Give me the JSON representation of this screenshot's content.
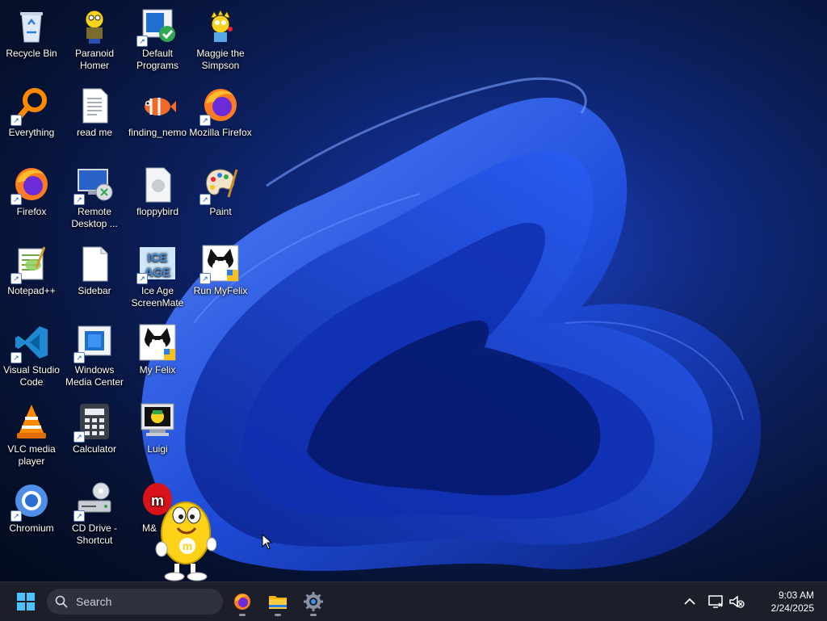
{
  "desktop": {
    "icons": [
      {
        "label": "Recycle Bin",
        "icon": "recycle-bin-icon",
        "shortcut": false
      },
      {
        "label": "Paranoid Homer",
        "icon": "homer-icon",
        "shortcut": false
      },
      {
        "label": "Default Programs",
        "icon": "default-programs-icon",
        "shortcut": true
      },
      {
        "label": "Maggie the Simpson",
        "icon": "maggie-icon",
        "shortcut": false
      },
      {
        "label": "Everything",
        "icon": "everything-search-icon",
        "shortcut": true
      },
      {
        "label": "read me",
        "icon": "text-file-icon",
        "shortcut": false
      },
      {
        "label": "finding_nemo",
        "icon": "nemo-fish-icon",
        "shortcut": false
      },
      {
        "label": "Mozilla Firefox",
        "icon": "firefox-icon",
        "shortcut": true
      },
      {
        "label": "Firefox",
        "icon": "firefox-icon",
        "shortcut": true
      },
      {
        "label": "Remote Desktop ...",
        "icon": "remote-desktop-icon",
        "shortcut": true
      },
      {
        "label": "floppybird",
        "icon": "generic-file-icon",
        "shortcut": false
      },
      {
        "label": "Paint",
        "icon": "paint-palette-icon",
        "shortcut": true
      },
      {
        "label": "Notepad++",
        "icon": "notepad-plus-plus-icon",
        "shortcut": true
      },
      {
        "label": "Sidebar",
        "icon": "blank-file-icon",
        "shortcut": false
      },
      {
        "label": "Ice Age ScreenMate",
        "icon": "ice-age-icon",
        "shortcut": true
      },
      {
        "label": "Run MyFelix",
        "icon": "felix-cat-icon",
        "shortcut": true
      },
      {
        "label": "Visual Studio Code",
        "icon": "vscode-icon",
        "shortcut": true
      },
      {
        "label": "Windows Media Center",
        "icon": "media-center-icon",
        "shortcut": true
      },
      {
        "label": "My Felix",
        "icon": "felix-cat-icon",
        "shortcut": false
      },
      {
        "label": "VLC media player",
        "icon": "vlc-cone-icon",
        "shortcut": false
      },
      {
        "label": "Calculator",
        "icon": "calculator-icon",
        "shortcut": true
      },
      {
        "label": "Luigi",
        "icon": "luigi-monitor-icon",
        "shortcut": false
      },
      {
        "label": "Chromium",
        "icon": "chromium-icon",
        "shortcut": true
      },
      {
        "label": "CD Drive - Shortcut",
        "icon": "cd-drive-icon",
        "shortcut": true
      },
      {
        "label": "M&",
        "icon": "m-and-m-icon",
        "shortcut": false
      }
    ]
  },
  "taskbar": {
    "start_icon": "windows-start-icon",
    "search_placeholder": "Search",
    "pinned": [
      {
        "name": "firefox",
        "icon": "firefox-icon",
        "running": true
      },
      {
        "name": "file-explorer",
        "icon": "folder-icon",
        "running": true
      },
      {
        "name": "settings",
        "icon": "gear-icon",
        "running": true
      }
    ],
    "tray": {
      "time": "9:03 AM",
      "date": "2/24/2025"
    }
  },
  "colors": {
    "taskbar_bg": "#1c1f2a",
    "accent": "#1a55c9",
    "wallpaper_bloom": "#1f4fe0"
  }
}
